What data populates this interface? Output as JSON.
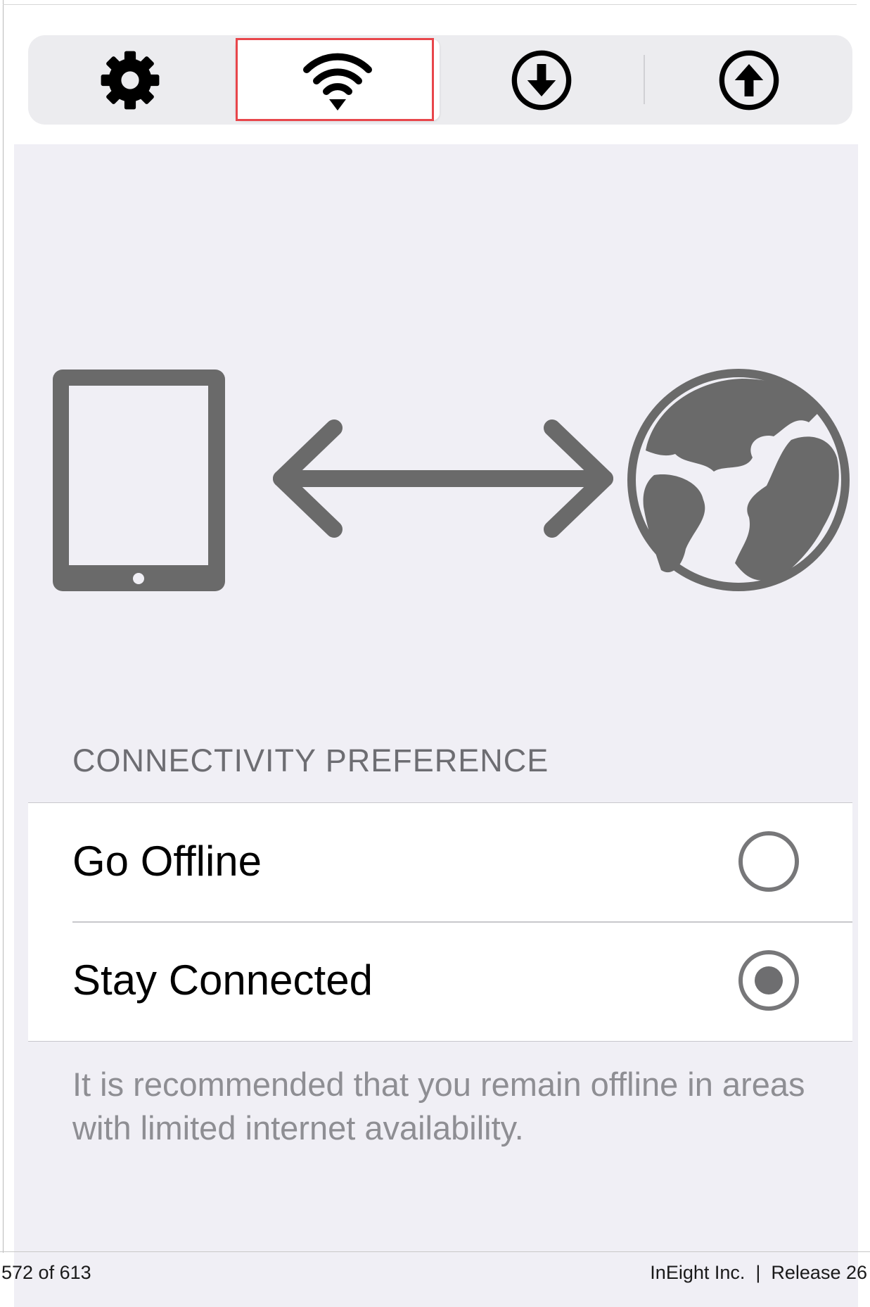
{
  "toolbar": {
    "segments": [
      {
        "id": "settings",
        "icon": "gear-icon",
        "selected": false
      },
      {
        "id": "connectivity",
        "icon": "wifi-icon",
        "selected": true
      },
      {
        "id": "download",
        "icon": "download-circle-icon",
        "selected": false
      },
      {
        "id": "upload",
        "icon": "upload-circle-icon",
        "selected": false
      }
    ]
  },
  "hero": {
    "icons": [
      "tablet-icon",
      "double-arrow-icon",
      "globe-icon"
    ],
    "color": "#6a6a6a"
  },
  "connectivity": {
    "section_title": "CONNECTIVITY PREFERENCE",
    "options": [
      {
        "label": "Go Offline",
        "selected": false
      },
      {
        "label": "Stay Connected",
        "selected": true
      }
    ],
    "footnote": "It is recommended that you remain offline in areas with limited internet availability."
  },
  "page_footer": {
    "page_info": "572 of 613",
    "company_release": "InEight Inc.  |  Release 26"
  },
  "colors": {
    "highlight": "#e8464b",
    "background": "#f0eff5",
    "icon": "#000000"
  }
}
